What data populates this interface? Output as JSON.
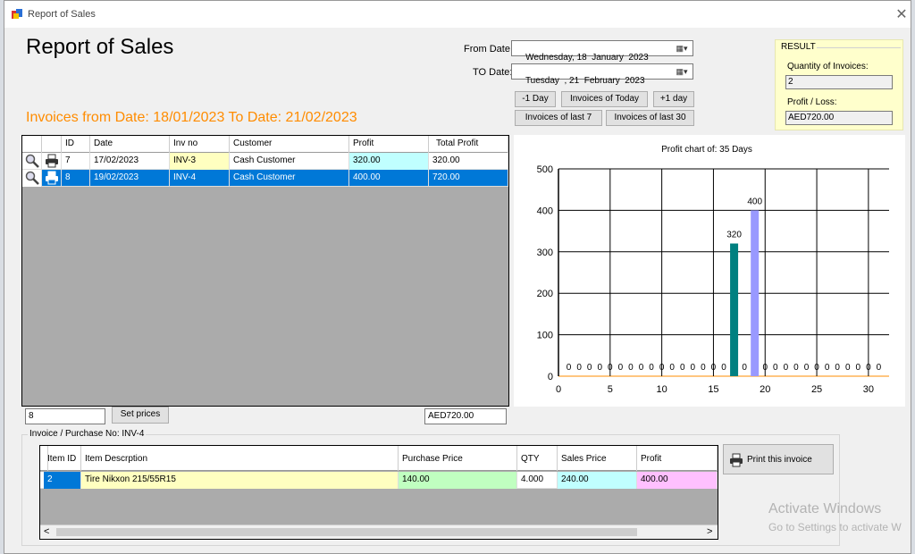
{
  "window": {
    "title": "Report of Sales",
    "close_glyph": "✕"
  },
  "heading": "Report of Sales",
  "subheading": "Invoices from Date: 18/01/2023  To Date: 21/02/2023",
  "filters": {
    "from_label": "From Date:",
    "from_value": "Wednesday, 18  January  2023",
    "to_label": "TO Date:",
    "to_value": "Tuesday  , 21  February  2023",
    "buttons": {
      "minus_day": "-1 Day",
      "today": "Invoices of Today",
      "plus_day": "+1 day",
      "last7": "Invoices of last 7",
      "last30": "Invoices of last 30"
    }
  },
  "result": {
    "title": "RESULT",
    "qty_label": "Quantity of Invoices:",
    "qty_value": "2",
    "profit_label": "Profit / Loss:",
    "profit_value": "AED720.00"
  },
  "invoices_grid": {
    "columns": [
      "ID",
      "Date",
      "Inv no",
      "Customer",
      "Profit",
      "Total Profit"
    ],
    "rows": [
      {
        "id": "7",
        "date": "17/02/2023",
        "inv": "INV-3",
        "customer": "Cash Customer",
        "profit": "320.00",
        "total": "320.00",
        "selected": false
      },
      {
        "id": "8",
        "date": "19/02/2023",
        "inv": "INV-4",
        "customer": "Cash Customer",
        "profit": "400.00",
        "total": "720.00",
        "selected": true
      }
    ]
  },
  "below_grid": {
    "id_value": "8",
    "set_prices": "Set prices",
    "total_value": "AED720.00"
  },
  "chart_data": {
    "type": "bar",
    "title": "Profit chart of: 35 Days",
    "xlim": [
      0,
      32
    ],
    "ylim": [
      0,
      500
    ],
    "x_ticks": [
      0,
      5,
      10,
      15,
      20,
      25,
      30
    ],
    "y_ticks": [
      0,
      100,
      200,
      300,
      400,
      500
    ],
    "grid": true,
    "series": [
      {
        "x": [
          17
        ],
        "values": [
          320
        ],
        "color": "#008080"
      },
      {
        "x": [
          19
        ],
        "values": [
          400
        ],
        "color": "#9999ff"
      }
    ],
    "zero_labels_x": [
      1,
      2,
      3,
      4,
      5,
      6,
      7,
      8,
      9,
      10,
      11,
      12,
      13,
      14,
      15,
      16,
      18,
      20,
      21,
      22,
      23,
      24,
      25,
      26,
      27,
      28,
      29,
      30,
      31
    ],
    "data_labels": [
      "320",
      "400",
      "0"
    ]
  },
  "invoice_detail": {
    "group_title": "Invoice / Purchase No: INV-4",
    "columns": [
      "Item ID",
      "Item Descrption",
      "Purchase Price",
      "QTY",
      "Sales Price",
      "Profit"
    ],
    "rows": [
      {
        "item_id": "2",
        "desc": "Tire Nikxon 215/55R15",
        "purchase": "140.00",
        "qty": "4.000",
        "sales": "240.00",
        "profit": "400.00"
      }
    ],
    "scroll_left": "<",
    "scroll_right": ">",
    "print_button": "Print this invoice"
  },
  "watermark": {
    "line1": "Activate Windows",
    "line2": "Go to Settings to activate W"
  },
  "colors": {
    "accent_orange": "#ff8c00",
    "selection_blue": "#0078d7",
    "inv_yellow": "#ffffc0",
    "profit_cyan": "#c0ffff",
    "purchase_green": "#c0ffc0",
    "profit_pink": "#ffc0ff"
  }
}
